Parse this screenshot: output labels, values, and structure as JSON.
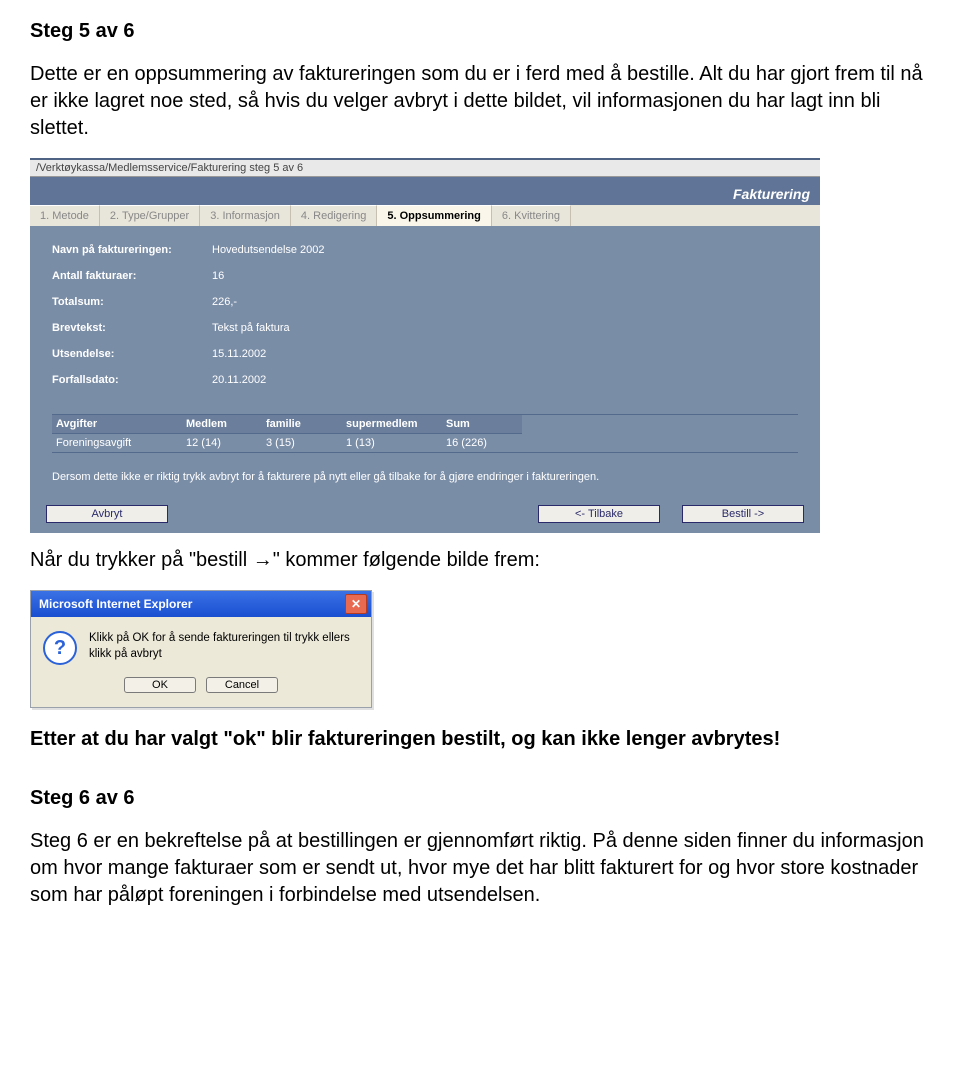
{
  "doc": {
    "h1": "Steg 5 av 6",
    "p1": "Dette er en oppsummering av faktureringen som du er i ferd med å bestille. Alt du har gjort frem til nå er ikke lagret noe sted, så hvis du velger avbryt i dette bildet, vil informasjonen du har lagt inn bli slettet.",
    "p2": "Når du trykker på \"bestill →\" kommer følgende bilde frem:",
    "p3": "Etter at du har valgt \"ok\" blir faktureringen bestilt, og kan ikke lenger avbrytes!",
    "h2": "Steg 6 av 6",
    "p4": "Steg 6 er en bekreftelse på at bestillingen er gjennomført riktig. På denne siden finner du informasjon om hvor mange fakturaer som er sendt ut, hvor mye det har blitt fakturert for og hvor store kostnader som har påløpt foreningen i forbindelse med utsendelsen."
  },
  "app": {
    "breadcrumb": "/Verktøykassa/Medlemsservice/Fakturering steg 5 av 6",
    "title": "Fakturering",
    "tabs": [
      "1. Metode",
      "2. Type/Grupper",
      "3. Informasjon",
      "4. Redigering",
      "5. Oppsummering",
      "6. Kvittering"
    ],
    "summary": {
      "navn_label": "Navn på faktureringen:",
      "navn_value": "Hovedutsendelse 2002",
      "antall_label": "Antall fakturaer:",
      "antall_value": "16",
      "totalsum_label": "Totalsum:",
      "totalsum_value": "226,-",
      "brevtekst_label": "Brevtekst:",
      "brevtekst_value": "Tekst på faktura",
      "utsendelse_label": "Utsendelse:",
      "utsendelse_value": "15.11.2002",
      "forfall_label": "Forfallsdato:",
      "forfall_value": "20.11.2002"
    },
    "fees": {
      "headers": [
        "Avgifter",
        "Medlem",
        "familie",
        "supermedlem",
        "Sum"
      ],
      "row_label": "Foreningsavgift",
      "row": [
        "12 (14)",
        "3 (15)",
        "1        (13)",
        "16 (226)"
      ]
    },
    "note": "Dersom dette ikke er riktig trykk avbryt for å fakturere på nytt eller gå tilbake for å gjøre endringer i faktureringen.",
    "buttons": {
      "avbryt": "Avbryt",
      "tilbake": "<- Tilbake",
      "bestill": "Bestill ->"
    }
  },
  "dialog": {
    "title": "Microsoft Internet Explorer",
    "message": "Klikk på OK for å sende faktureringen til trykk ellers klikk på avbryt",
    "ok": "OK",
    "cancel": "Cancel"
  }
}
